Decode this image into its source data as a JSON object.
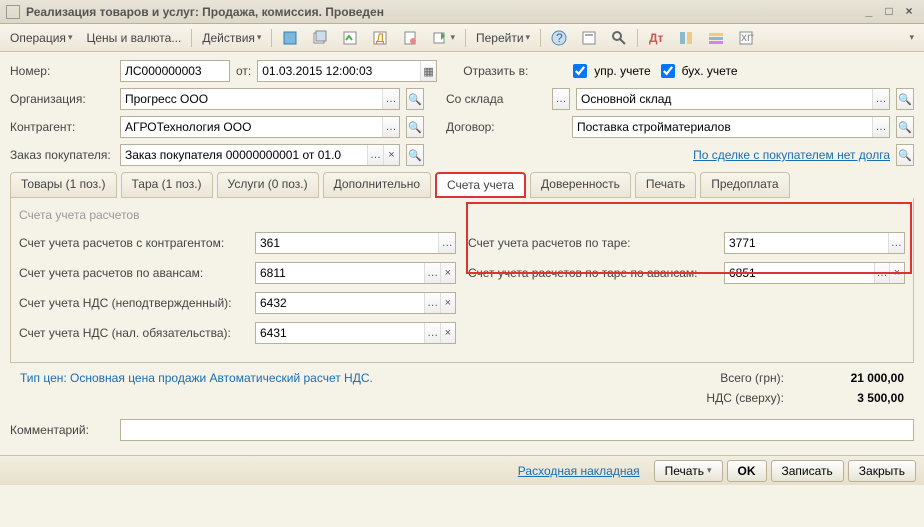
{
  "window": {
    "title": "Реализация товаров и услуг: Продажа, комиссия. Проведен"
  },
  "toolbar": {
    "operation": "Операция",
    "prices": "Цены и валюта...",
    "actions": "Действия",
    "goto": "Перейти"
  },
  "header": {
    "number_lbl": "Номер:",
    "number": "ЛС000000003",
    "from_lbl": "от:",
    "date": "01.03.2015 12:00:03",
    "reflect_lbl": "Отразить в:",
    "chk1_lbl": "упр. учете",
    "chk2_lbl": "бух. учете",
    "org_lbl": "Организация:",
    "org": "Прогресс ООО",
    "warehouse_lbl": "Со склада",
    "warehouse": "Основной склад",
    "contr_lbl": "Контрагент:",
    "contr": "АГРОТехнология ООО",
    "contract_lbl": "Договор:",
    "contract": "Поставка стройматериалов",
    "order_lbl": "Заказ покупателя:",
    "order": "Заказ покупателя 00000000001 от 01.0",
    "debt_link": "По сделке с покупателем нет долга"
  },
  "tabs": {
    "t1": "Товары (1 поз.)",
    "t2": "Тара (1 поз.)",
    "t3": "Услуги (0 поз.)",
    "t4": "Дополнительно",
    "t5": "Счета учета",
    "t6": "Доверенность",
    "t7": "Печать",
    "t8": "Предоплата"
  },
  "panel": {
    "group": "Счета учета расчетов",
    "r1_lbl": "Счет учета расчетов с контрагентом:",
    "r1": "361",
    "r2_lbl": "Счет учета расчетов по авансам:",
    "r2": "6811",
    "r3_lbl": "Счет учета НДС (неподтвержденный):",
    "r3": "6432",
    "r4_lbl": "Счет учета НДС (нал. обязательства):",
    "r4": "6431",
    "r5_lbl": "Счет учета расчетов по таре:",
    "r5": "3771",
    "r6_lbl": "Счет учета расчетов по таре по авансам:",
    "r6": "6851"
  },
  "footer": {
    "price_type": "Тип цен: Основная цена продажи Автоматический расчет НДС.",
    "total_lbl": "Всего (грн):",
    "total": "21 000,00",
    "vat_lbl": "НДС (сверху):",
    "vat": "3 500,00",
    "comment_lbl": "Комментарий:"
  },
  "botbar": {
    "invoice": "Расходная накладная",
    "print": "Печать",
    "ok": "OK",
    "save": "Записать",
    "close": "Закрыть"
  }
}
